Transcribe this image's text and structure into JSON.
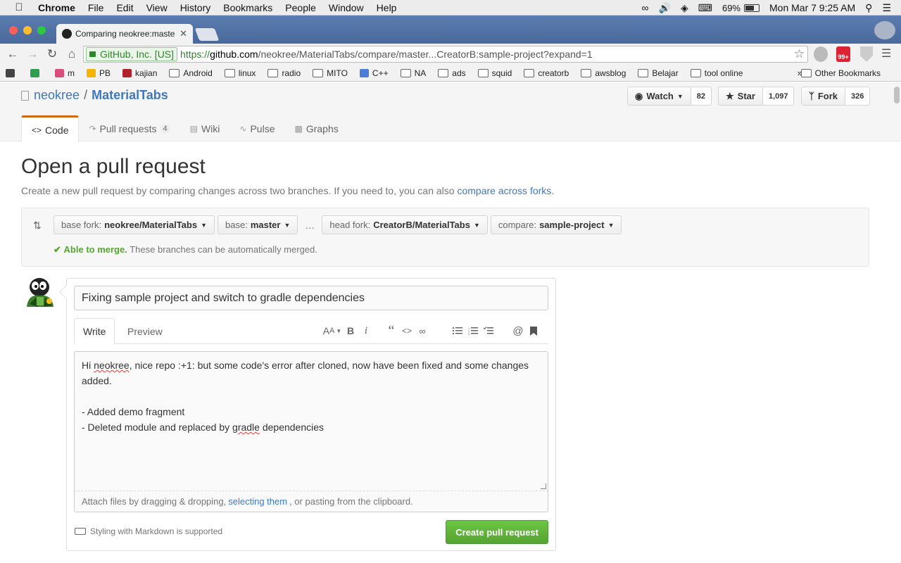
{
  "menubar": {
    "app": "Chrome",
    "items": [
      "File",
      "Edit",
      "View",
      "History",
      "Bookmarks",
      "People",
      "Window",
      "Help"
    ],
    "battery": "69%",
    "clock": "Mon Mar 7  9:25 AM"
  },
  "browser": {
    "tab_title": "Comparing neokree:master",
    "ev_label": "GitHub, Inc. [US]",
    "url_scheme": "https://",
    "url_host": "github.com",
    "url_path": "/neokree/MaterialTabs/compare/master...CreatorB:sample-project?expand=1",
    "ext_badge": "99+"
  },
  "bookmarks": {
    "items": [
      "m",
      "PB",
      "kajian",
      "Android",
      "linux",
      "radio",
      "MITO",
      "C++",
      "NA",
      "ads",
      "squid",
      "creatorb",
      "awsblog",
      "Belajar",
      "tool online"
    ],
    "chevron": "»",
    "other": "Other Bookmarks"
  },
  "repo": {
    "owner": "neokree",
    "separator": "/",
    "name": "MaterialTabs",
    "watch_label": "Watch",
    "watch_count": "82",
    "star_label": "Star",
    "star_count": "1,097",
    "fork_label": "Fork",
    "fork_count": "326",
    "tabs": {
      "code": "Code",
      "pulls": "Pull requests",
      "pulls_count": "4",
      "wiki": "Wiki",
      "pulse": "Pulse",
      "graphs": "Graphs"
    }
  },
  "compare": {
    "title": "Open a pull request",
    "subtitle": "Create a new pull request by comparing changes across two branches. If you need to, you can also",
    "subtitle_link": "compare across forks",
    "subtitle_end": ".",
    "base_fork_label": "base fork:",
    "base_fork": "neokree/MaterialTabs",
    "base_label": "base:",
    "base": "master",
    "ellipsis": "…",
    "head_fork_label": "head fork:",
    "head_fork": "CreatorB/MaterialTabs",
    "compare_label": "compare:",
    "compare": "sample-project",
    "merge_ok": "Able to merge.",
    "merge_text": "These branches can be automatically merged."
  },
  "form": {
    "title_value": "Fixing sample project and switch to gradle dependencies",
    "tab_write": "Write",
    "tab_preview": "Preview",
    "body_lines": [
      "Hi neokree, nice repo :+1: but some code's error after cloned, now have been fixed and some changes added.",
      "",
      "- Added demo fragment",
      "- Deleted module and replaced by gradle dependencies"
    ],
    "attach_prefix": "Attach files by dragging & dropping,",
    "attach_link": "selecting them",
    "attach_suffix": ", or pasting from the clipboard.",
    "markdown_note": "Styling with Markdown is supported",
    "submit": "Create pull request"
  },
  "colors": {
    "accent_link": "#4078c0",
    "merge_green": "#55a532",
    "button_green": "#6cc644",
    "tab_underline": "#d26911"
  }
}
